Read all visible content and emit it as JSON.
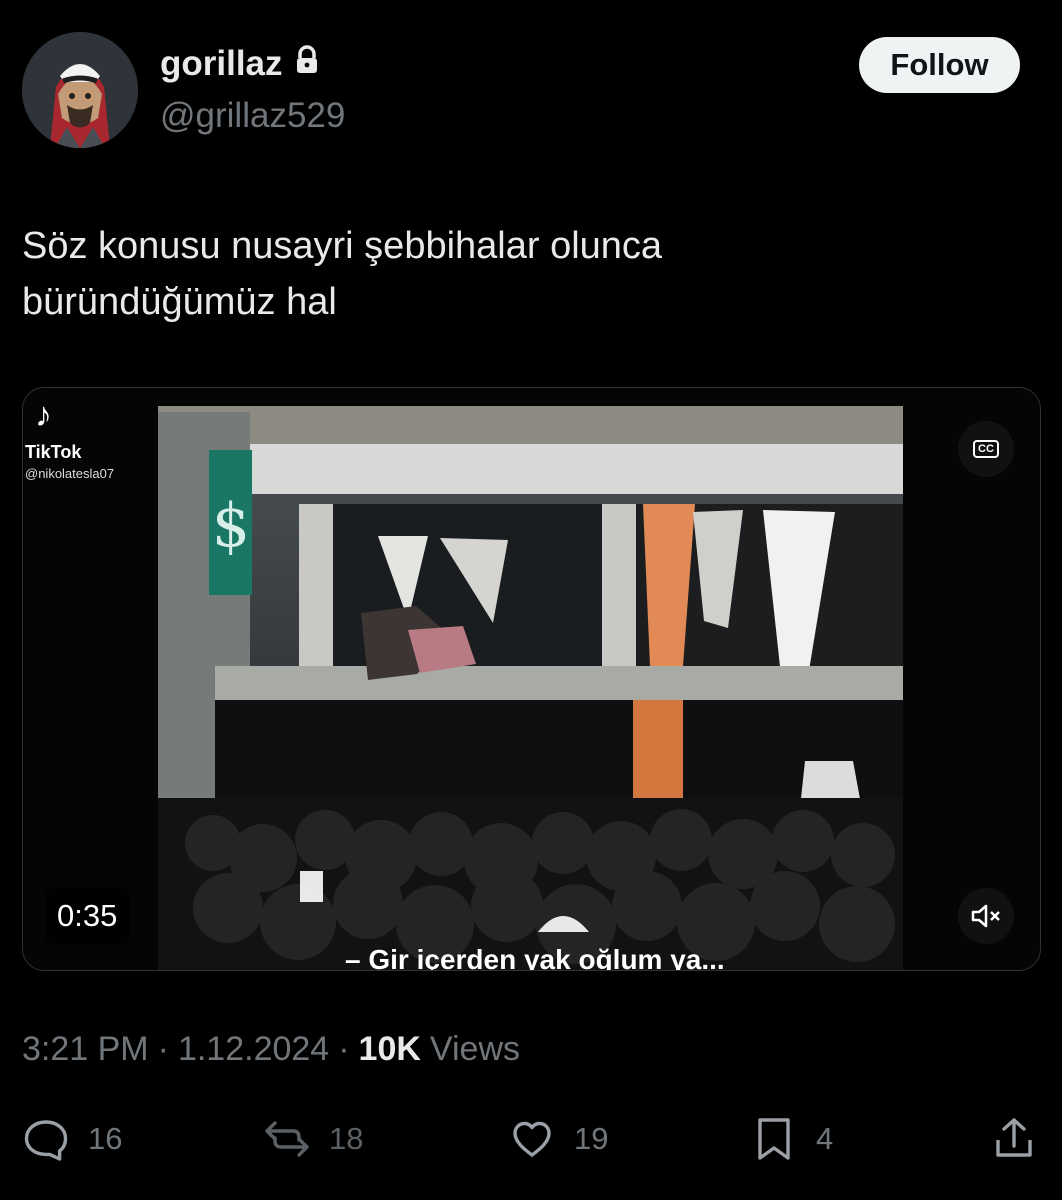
{
  "tweet": {
    "display_name": "gorillaz",
    "handle": "@grillaz529",
    "follow_label": "Follow",
    "text_line_1": "Söz konusu nusayri şebbihalar olunca",
    "text_line_2": "büründüğümüz hal",
    "time": "3:21 PM",
    "date": "1.12.2024",
    "views_count": "10K",
    "views_label": "Views"
  },
  "media": {
    "platform_logo_text": "♪",
    "platform_name": "TikTok",
    "source_user": "@nikolatesla07",
    "duration": "0:35",
    "caption_badge": "CC",
    "subtitle": "– Gir içerden yak oğlum ya..."
  },
  "actions": {
    "replies": "16",
    "reposts": "18",
    "likes": "19",
    "bookmarks": "4"
  },
  "colors": {
    "background": "#000000",
    "primary_text": "#e7e9ea",
    "secondary_text": "#71767b",
    "follow_button": "#eff3f4"
  }
}
